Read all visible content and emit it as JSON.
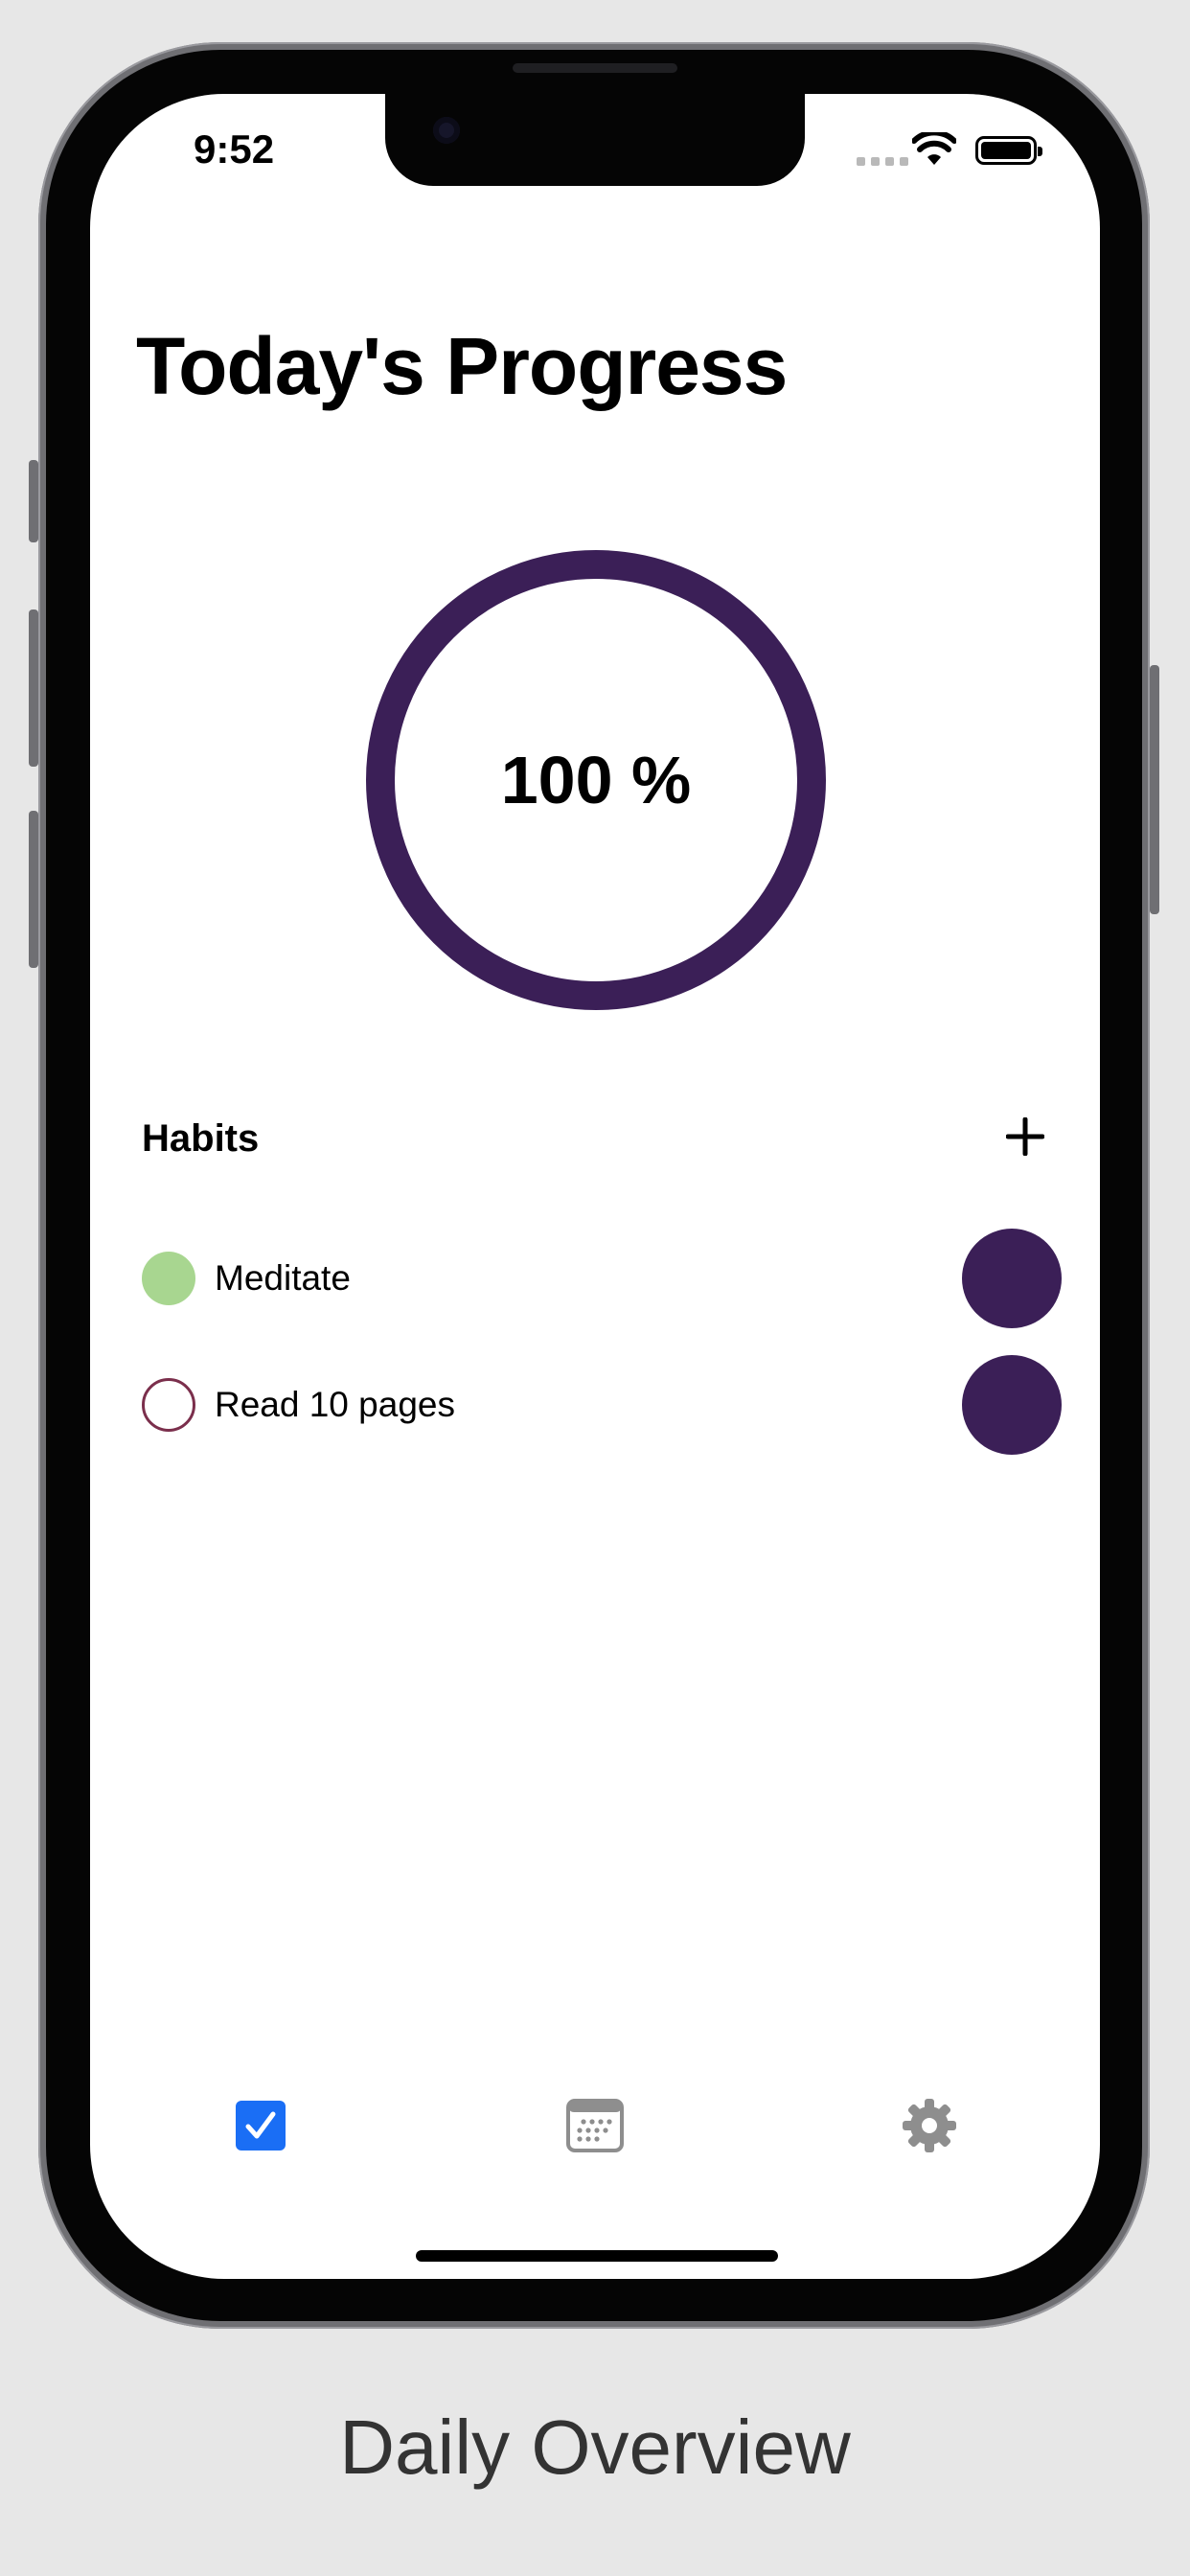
{
  "status_bar": {
    "time": "9:52"
  },
  "header": {
    "title": "Today's Progress"
  },
  "progress": {
    "value_text": "100 %",
    "percent": 100,
    "ring_color": "#3b1f57"
  },
  "habits": {
    "label": "Habits",
    "add_icon": "plus-icon",
    "items": [
      {
        "name": "Meditate",
        "completed": true,
        "dot_color": "#a8d690"
      },
      {
        "name": "Read 10 pages",
        "completed": false,
        "dot_color": "#7b2f4c"
      }
    ]
  },
  "tab_bar": {
    "tabs": [
      {
        "icon": "checkbox-icon",
        "active": true,
        "color": "#1a6ef5"
      },
      {
        "icon": "calendar-icon",
        "active": false,
        "color": "#8e8e8e"
      },
      {
        "icon": "gear-icon",
        "active": false,
        "color": "#8e8e8e"
      }
    ]
  },
  "caption": {
    "text": "Daily Overview"
  },
  "theme": {
    "accent": "#3b1f57",
    "background": "#e7e7e7"
  }
}
